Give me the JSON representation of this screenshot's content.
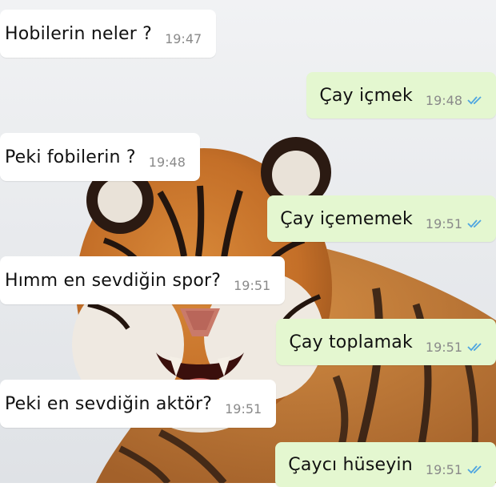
{
  "chat": {
    "messages": [
      {
        "direction": "incoming",
        "text": "Hobilerin neler ?",
        "time": "19:47"
      },
      {
        "direction": "outgoing",
        "text": "Çay içmek",
        "time": "19:48",
        "status": "read"
      },
      {
        "direction": "incoming",
        "text": "Peki fobilerin ?",
        "time": "19:48"
      },
      {
        "direction": "outgoing",
        "text": "Çay içememek",
        "time": "19:51",
        "status": "read"
      },
      {
        "direction": "incoming",
        "text": "Hımm en sevdiğin spor?",
        "time": "19:51"
      },
      {
        "direction": "outgoing",
        "text": "Çay toplamak",
        "time": "19:51",
        "status": "read"
      },
      {
        "direction": "incoming",
        "text": "Peki en sevdiğin aktör?",
        "time": "19:51"
      },
      {
        "direction": "outgoing",
        "text": "Çaycı hüseyin",
        "time": "19:51",
        "status": "read"
      }
    ]
  },
  "colors": {
    "incoming_bubble": "#ffffff",
    "outgoing_bubble": "#e4f7d0",
    "read_ticks": "#4fa6e0",
    "timestamp": "#8a8a8a"
  },
  "background": {
    "subject": "tiger-photo"
  }
}
